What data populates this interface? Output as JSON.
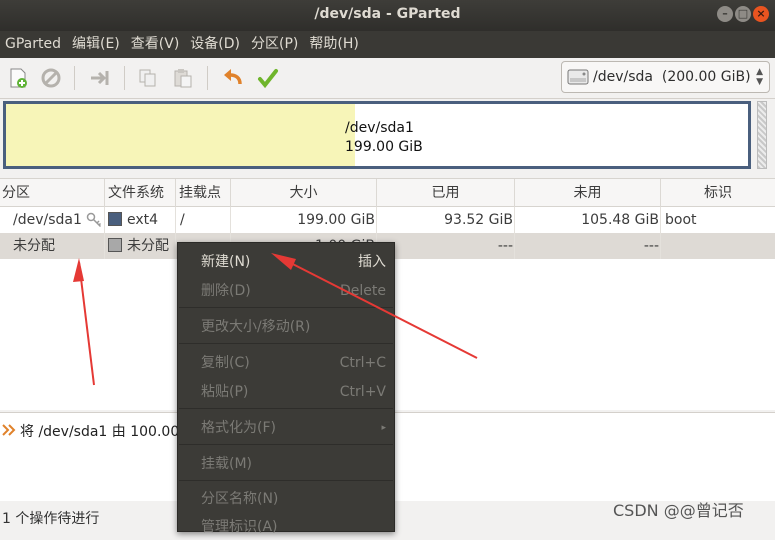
{
  "window": {
    "title": "/dev/sda - GParted"
  },
  "menubar": [
    "GParted",
    "编辑(E)",
    "查看(V)",
    "设备(D)",
    "分区(P)",
    "帮助(H)"
  ],
  "device_selector": {
    "value": "/dev/sda  (200.00 GiB)"
  },
  "disk_map": {
    "name": "/dev/sda1",
    "size": "199.00 GiB",
    "used_fraction": 0.4699,
    "colors": {
      "used": "#f7f5b8",
      "border": "#4a5f7e"
    }
  },
  "table": {
    "headers": [
      "分区",
      "文件系统",
      "挂载点",
      "大小",
      "已用",
      "未用",
      "标识"
    ],
    "rows": [
      {
        "partition": "/dev/sda1",
        "filesystem": "ext4",
        "fs_color": "#4a5f7e",
        "mountpoint": "/",
        "size": "199.00 GiB",
        "used": "93.52 GiB",
        "unused": "105.48 GiB",
        "flags": "boot"
      },
      {
        "partition": "未分配",
        "filesystem": "未分配",
        "fs_color": "#a8a8a8",
        "mountpoint": "",
        "size": "1.00 GiB",
        "used": "---",
        "unused": "---",
        "flags": ""
      }
    ]
  },
  "pending": {
    "operation": "将 /dev/sda1 由 100.00 GiB"
  },
  "status": "1 个操作待进行",
  "context_menu": [
    {
      "label": "新建(N)",
      "accel": "插入",
      "disabled": false
    },
    {
      "label": "删除(D)",
      "accel": "Delete",
      "disabled": true
    },
    {
      "label": "更改大小/移动(R)",
      "accel": "",
      "disabled": true
    },
    {
      "label": "复制(C)",
      "accel": "Ctrl+C",
      "disabled": true
    },
    {
      "label": "粘贴(P)",
      "accel": "Ctrl+V",
      "disabled": true
    },
    {
      "label": "格式化为(F)",
      "accel": "",
      "disabled": true
    },
    {
      "label": "挂载(M)",
      "accel": "",
      "disabled": true
    },
    {
      "label": "分区名称(N)",
      "accel": "",
      "disabled": true
    },
    {
      "label": "管理标识(A)",
      "accel": "",
      "disabled": true
    }
  ],
  "watermark": "CSDN @@曾记否",
  "colors": {
    "accent": "#e95420",
    "menu_bg": "#3c3b37",
    "annotation_red": "#e53935"
  }
}
